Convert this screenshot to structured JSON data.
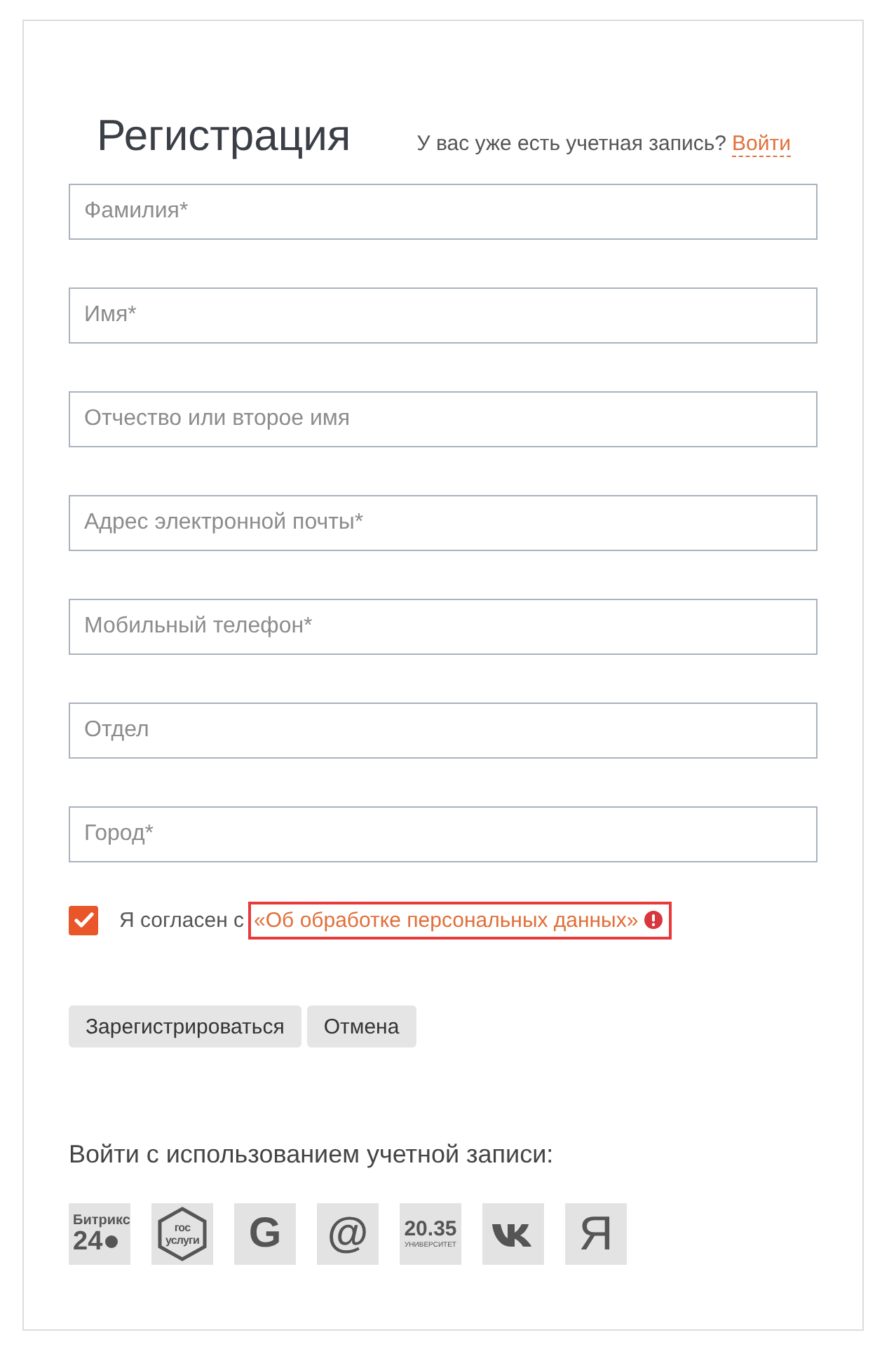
{
  "title": "Регистрация",
  "login_prompt": {
    "text": "У вас уже есть учетная запись?",
    "link": "Войти"
  },
  "fields": [
    {
      "placeholder": "Фамилия*"
    },
    {
      "placeholder": "Имя*"
    },
    {
      "placeholder": "Отчество или второе имя"
    },
    {
      "placeholder": "Адрес электронной почты*"
    },
    {
      "placeholder": "Мобильный телефон*"
    },
    {
      "placeholder": "Отдел"
    },
    {
      "placeholder": "Город*"
    }
  ],
  "consent": {
    "checked": true,
    "text": "Я согласен с",
    "link": "«Об обработке персональных данных»",
    "error": true
  },
  "buttons": [
    "Зарегистрироваться",
    "Отмена"
  ],
  "social_heading": "Войти с использованием учетной записи:",
  "social": [
    {
      "kind": "bitrix",
      "lines": [
        "Битрикс",
        "24"
      ]
    },
    {
      "kind": "gosuslugi",
      "lines": [
        "гос",
        "услуги"
      ]
    },
    {
      "kind": "letter",
      "lines": [
        "G"
      ]
    },
    {
      "kind": "letter",
      "lines": [
        "@"
      ]
    },
    {
      "kind": "university",
      "lines": [
        "20.35",
        "УНИВЕРСИТЕТ"
      ]
    },
    {
      "kind": "vk"
    },
    {
      "kind": "yandex",
      "lines": [
        "Я"
      ]
    }
  ]
}
